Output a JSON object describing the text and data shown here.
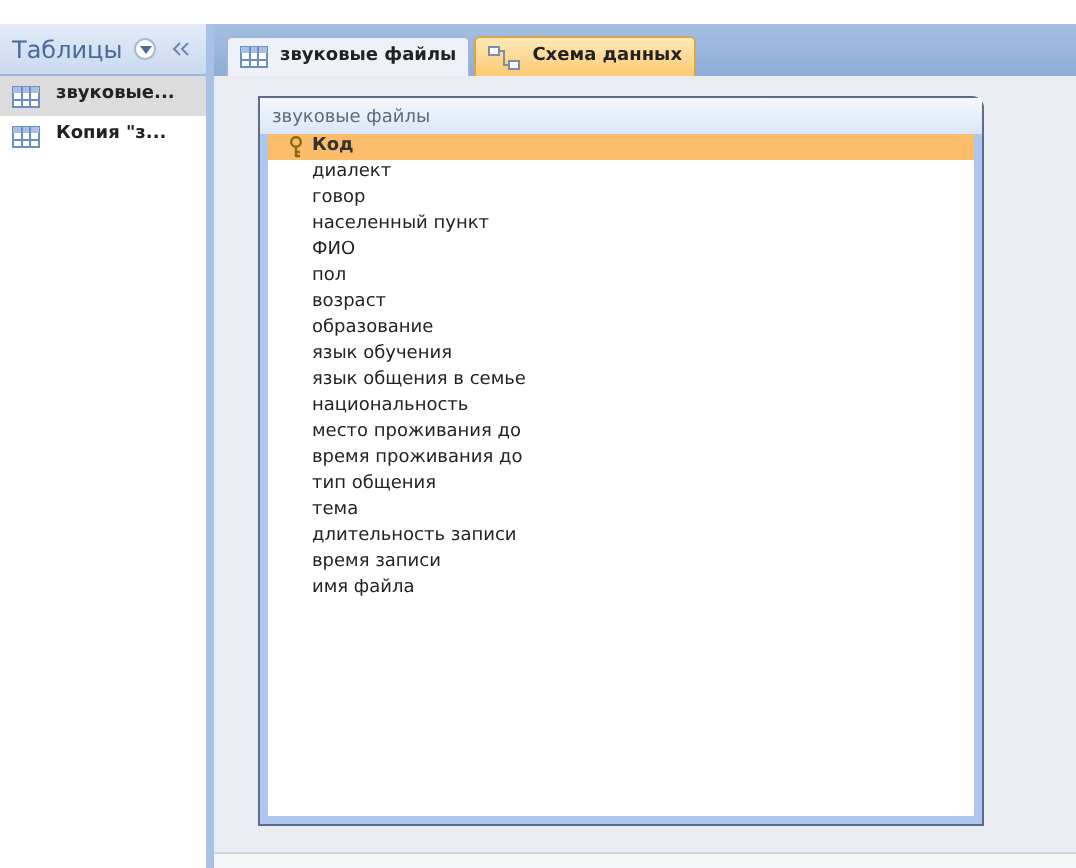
{
  "sidebar": {
    "title": "Таблицы",
    "items": [
      {
        "label": "звуковые...",
        "selected": true
      },
      {
        "label": "Копия \"з...",
        "selected": false
      }
    ]
  },
  "tabs": [
    {
      "label": "звуковые файлы",
      "kind": "table",
      "selected": false
    },
    {
      "label": "Схема данных",
      "kind": "diagram",
      "selected": true
    }
  ],
  "table_box": {
    "title": "звуковые файлы",
    "fields": [
      {
        "name": "Код",
        "key": true,
        "selected": true
      },
      {
        "name": "диалект",
        "key": false,
        "selected": false
      },
      {
        "name": "говор",
        "key": false,
        "selected": false
      },
      {
        "name": "населенный пункт",
        "key": false,
        "selected": false
      },
      {
        "name": "ФИО",
        "key": false,
        "selected": false
      },
      {
        "name": "пол",
        "key": false,
        "selected": false
      },
      {
        "name": "возраст",
        "key": false,
        "selected": false
      },
      {
        "name": "образование",
        "key": false,
        "selected": false
      },
      {
        "name": "язык обучения",
        "key": false,
        "selected": false
      },
      {
        "name": "язык общения в семье",
        "key": false,
        "selected": false
      },
      {
        "name": "национальность",
        "key": false,
        "selected": false
      },
      {
        "name": "место проживания до",
        "key": false,
        "selected": false
      },
      {
        "name": "время проживания до",
        "key": false,
        "selected": false
      },
      {
        "name": "тип общения",
        "key": false,
        "selected": false
      },
      {
        "name": "тема",
        "key": false,
        "selected": false
      },
      {
        "name": "длительность записи",
        "key": false,
        "selected": false
      },
      {
        "name": "время записи",
        "key": false,
        "selected": false
      },
      {
        "name": "имя файла",
        "key": false,
        "selected": false
      }
    ]
  }
}
